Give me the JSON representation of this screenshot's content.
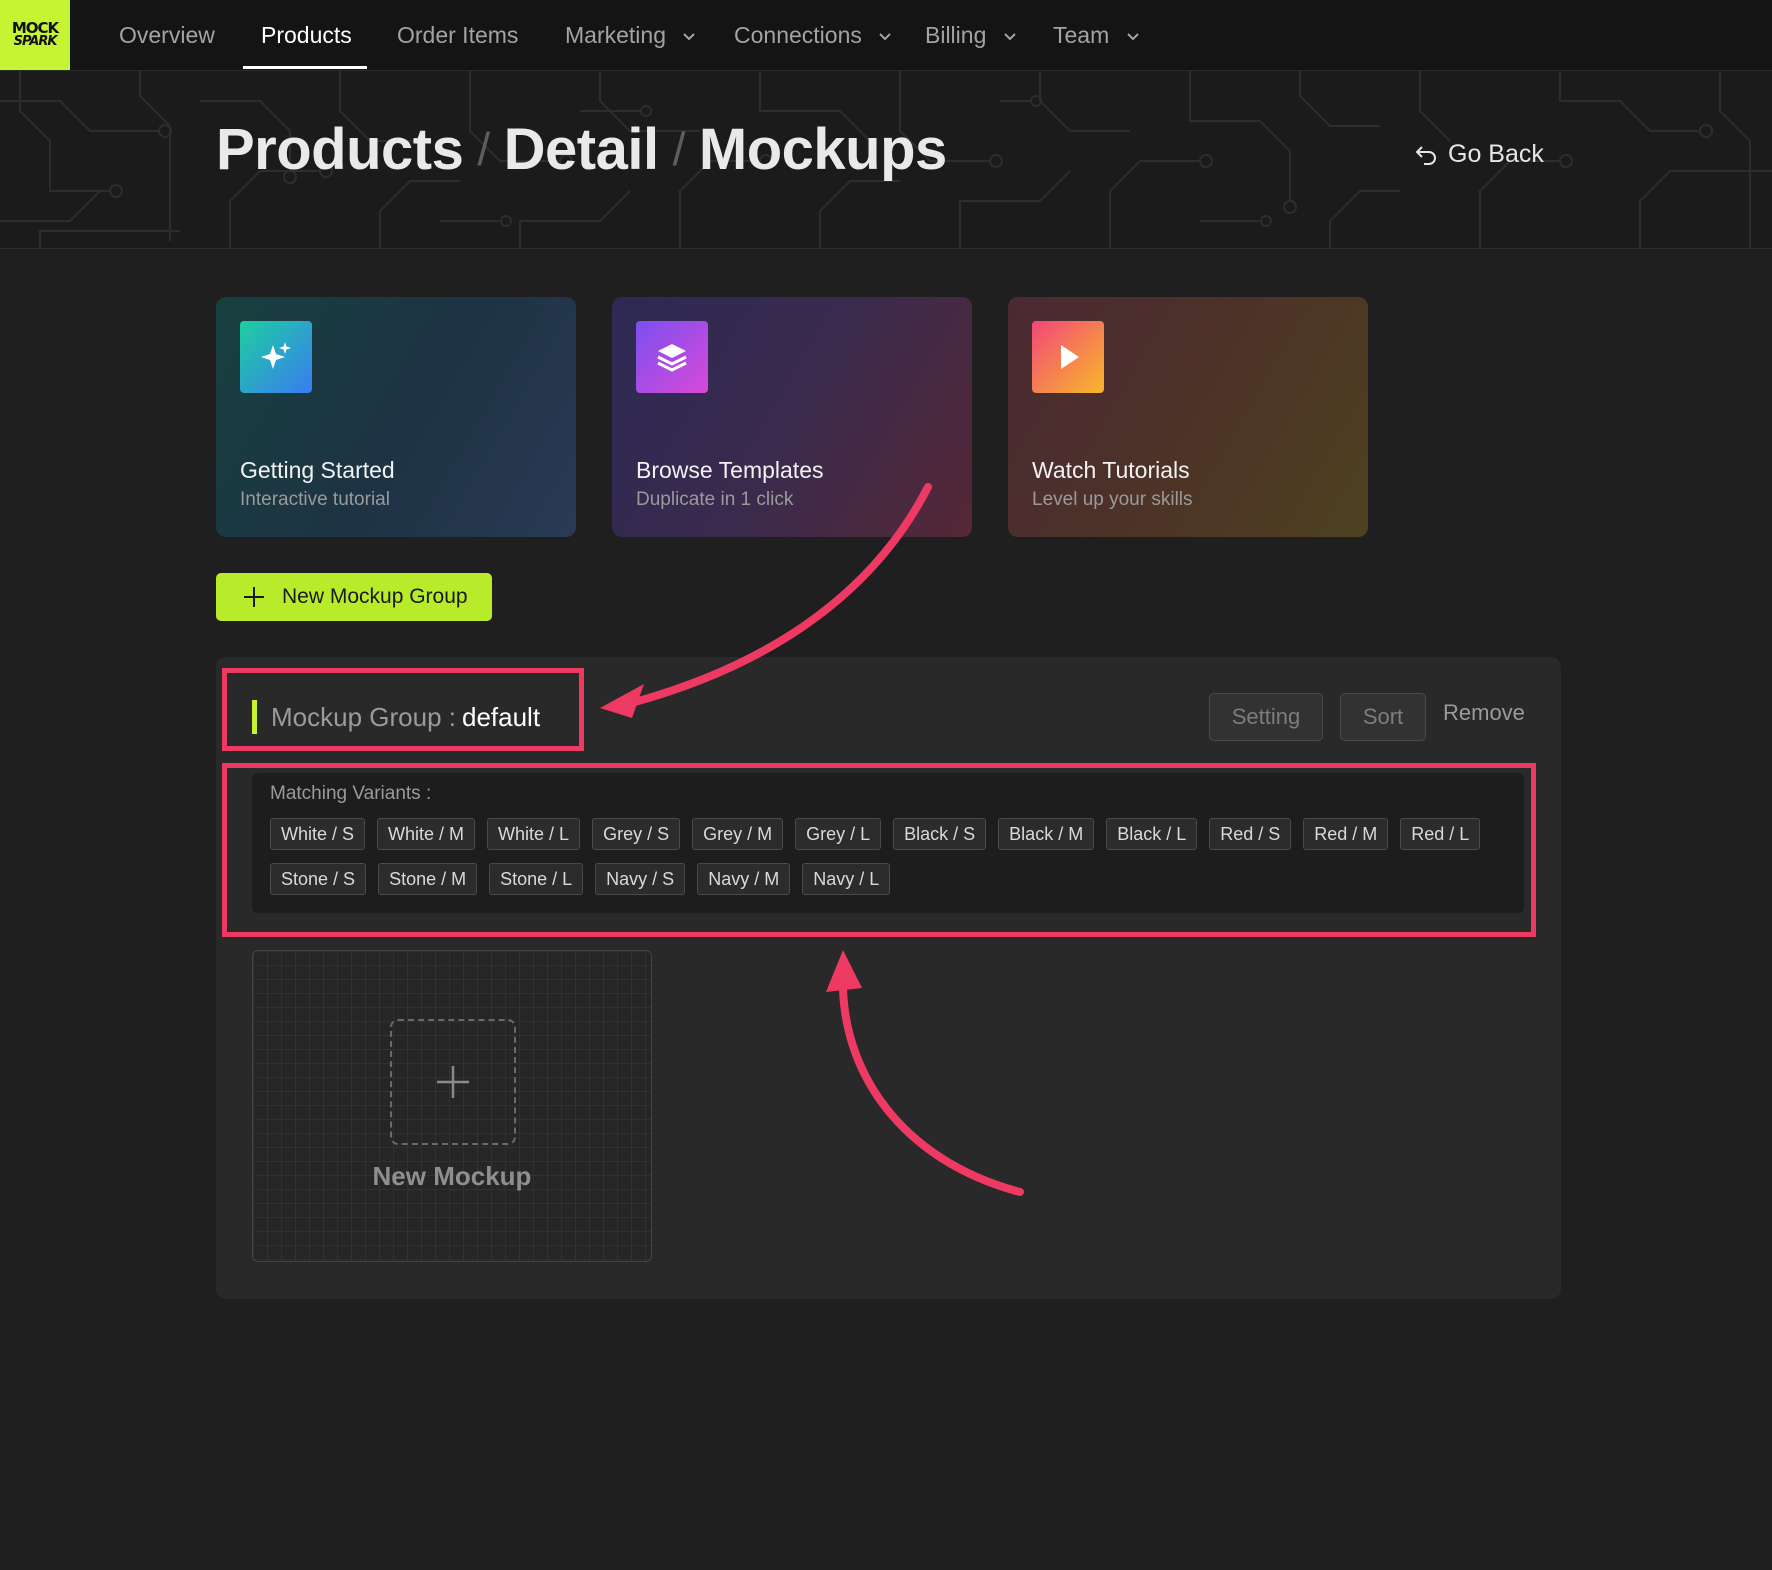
{
  "logo": {
    "line1": "MOCK",
    "line2": "SPARK"
  },
  "nav": {
    "items": [
      {
        "label": "Overview"
      },
      {
        "label": "Products"
      },
      {
        "label": "Order Items"
      },
      {
        "label": "Marketing"
      },
      {
        "label": "Connections"
      },
      {
        "label": "Billing"
      },
      {
        "label": "Team"
      }
    ]
  },
  "breadcrumb": {
    "part1": "Products",
    "part2": "Detail",
    "part3": "Mockups",
    "separator": "/"
  },
  "go_back": {
    "label": "Go Back",
    "icon": "undo-arrow-icon"
  },
  "cards": [
    {
      "title": "Getting Started",
      "subtitle": "Interactive tutorial",
      "icon": "sparkles-icon"
    },
    {
      "title": "Browse Templates",
      "subtitle": "Duplicate in 1 click",
      "icon": "layers-icon"
    },
    {
      "title": "Watch Tutorials",
      "subtitle": "Level up your skills",
      "icon": "play-icon"
    }
  ],
  "new_group_button": {
    "label": "New Mockup Group",
    "icon": "plus-icon"
  },
  "mockup_group": {
    "label": "Mockup Group :",
    "name": "default",
    "setting_label": "Setting",
    "sort_label": "Sort",
    "remove_label": "Remove",
    "variants_label": "Matching Variants :",
    "variants": [
      "White / S",
      "White / M",
      "White / L",
      "Grey / S",
      "Grey / M",
      "Grey / L",
      "Black / S",
      "Black / M",
      "Black / L",
      "Red / S",
      "Red / M",
      "Red / L",
      "Stone / S",
      "Stone / M",
      "Stone / L",
      "Navy / S",
      "Navy / M",
      "Navy / L"
    ]
  },
  "new_mockup": {
    "label": "New Mockup",
    "icon": "plus-icon"
  },
  "colors": {
    "accent": "#c6f432",
    "annotation": "#ee3a63",
    "background": "#1f1f1f"
  }
}
